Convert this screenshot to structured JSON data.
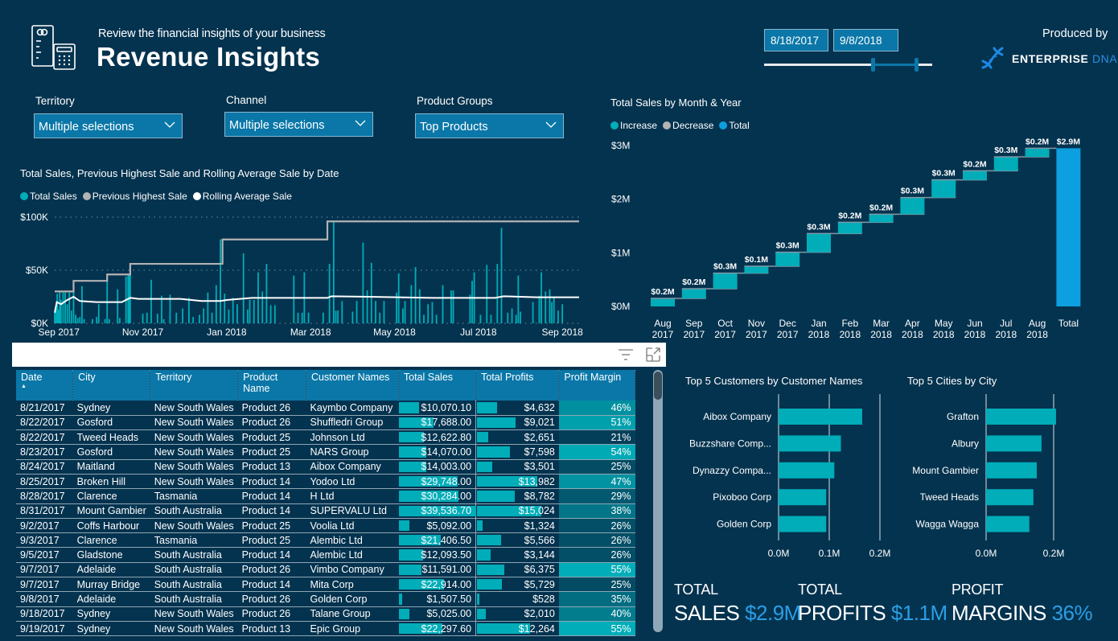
{
  "header": {
    "subtitle": "Review the financial insights of your business",
    "title": "Revenue Insights",
    "produced_by": "Produced by",
    "brand_main": "ENTERPRISE",
    "brand_accent": "DNA"
  },
  "date_range": {
    "start": "8/18/2017",
    "end": "9/8/2018",
    "slider_start_fraction": 0.64,
    "slider_end_fraction": 0.9
  },
  "slicers": [
    {
      "label": "Territory",
      "value": "Multiple selections"
    },
    {
      "label": "Channel",
      "value": "Multiple selections"
    },
    {
      "label": "Product Groups",
      "value": "Top Products"
    }
  ],
  "colors": {
    "background": "#04334f",
    "accent_blue": "#0a77a8",
    "teal": "#00adb8",
    "grey": "#b3b3b3",
    "total_blue": "#0e9fe0",
    "kpi_value": "#2b9ee6"
  },
  "chart_data": [
    {
      "id": "line",
      "type": "line",
      "title": "Total Sales, Previous Highest Sale and Rolling Average Sale by Date",
      "legend": [
        {
          "name": "Total Sales",
          "color": "#00adb8"
        },
        {
          "name": "Previous Highest Sale",
          "color": "#b3b3b3"
        },
        {
          "name": "Rolling Average Sale",
          "color": "#ffffff"
        }
      ],
      "y_ticks": [
        "$0K",
        "$50K",
        "$100K"
      ],
      "ylim": [
        0,
        100000
      ],
      "x_ticks": [
        "Sep 2017",
        "Nov 2017",
        "Jan 2018",
        "Mar 2018",
        "May 2018",
        "Jul 2018",
        "Sep 2018"
      ],
      "x_range_months": [
        0,
        12.5
      ],
      "previous_highest_steps": [
        {
          "x": 0.0,
          "y": 30000
        },
        {
          "x": 0.45,
          "y": 40000
        },
        {
          "x": 1.25,
          "y": 46000
        },
        {
          "x": 1.8,
          "y": 56000
        },
        {
          "x": 4.0,
          "y": 79000
        },
        {
          "x": 6.5,
          "y": 96000
        },
        {
          "x": 12.5,
          "y": 96000
        }
      ],
      "rolling_average": [
        {
          "x": 0.0,
          "y": 10000
        },
        {
          "x": 0.05,
          "y": 20000
        },
        {
          "x": 0.15,
          "y": 18000
        },
        {
          "x": 0.3,
          "y": 22000
        },
        {
          "x": 0.45,
          "y": 25000
        },
        {
          "x": 0.6,
          "y": 21000
        },
        {
          "x": 1.0,
          "y": 20000
        },
        {
          "x": 1.3,
          "y": 20000
        },
        {
          "x": 1.6,
          "y": 20000
        },
        {
          "x": 1.8,
          "y": 24000
        },
        {
          "x": 2.0,
          "y": 23000
        },
        {
          "x": 2.5,
          "y": 23000
        },
        {
          "x": 3.0,
          "y": 23000
        },
        {
          "x": 3.5,
          "y": 21000
        },
        {
          "x": 3.95,
          "y": 21000
        },
        {
          "x": 4.1,
          "y": 22000
        },
        {
          "x": 4.7,
          "y": 24000
        },
        {
          "x": 5.5,
          "y": 24000
        },
        {
          "x": 6.5,
          "y": 24000
        },
        {
          "x": 6.6,
          "y": 25500
        },
        {
          "x": 7.5,
          "y": 25000
        },
        {
          "x": 9.0,
          "y": 24000
        },
        {
          "x": 10.5,
          "y": 24000
        },
        {
          "x": 10.7,
          "y": 25500
        },
        {
          "x": 11.5,
          "y": 24500
        },
        {
          "x": 12.5,
          "y": 24500
        }
      ],
      "total_sales_bars": [
        [
          0.0,
          10000
        ],
        [
          0.03,
          15000
        ],
        [
          0.06,
          28000
        ],
        [
          0.09,
          13000
        ],
        [
          0.12,
          30000
        ],
        [
          0.15,
          22000
        ],
        [
          0.2,
          29000
        ],
        [
          0.25,
          29000
        ],
        [
          0.3,
          18000
        ],
        [
          0.35,
          29000
        ],
        [
          0.4,
          12000
        ],
        [
          0.45,
          40000
        ],
        [
          0.5,
          8000
        ],
        [
          0.55,
          5000
        ],
        [
          0.6,
          6000
        ],
        [
          0.65,
          35000
        ],
        [
          0.7,
          4000
        ],
        [
          0.9,
          4000
        ],
        [
          1.0,
          6000
        ],
        [
          1.05,
          18000
        ],
        [
          1.2,
          4000
        ],
        [
          1.25,
          40000
        ],
        [
          1.3,
          4000
        ],
        [
          1.5,
          32000
        ],
        [
          1.55,
          5000
        ],
        [
          1.7,
          44000
        ],
        [
          1.75,
          45000
        ],
        [
          1.78,
          46000
        ],
        [
          1.8,
          56000
        ],
        [
          2.1,
          9000
        ],
        [
          2.2,
          10000
        ],
        [
          2.3,
          41000
        ],
        [
          2.45,
          9000
        ],
        [
          2.55,
          26000
        ],
        [
          2.6,
          4000
        ],
        [
          2.75,
          27000
        ],
        [
          2.9,
          10000
        ],
        [
          3.05,
          14000
        ],
        [
          3.2,
          24000
        ],
        [
          3.3,
          6000
        ],
        [
          3.45,
          8000
        ],
        [
          3.55,
          14000
        ],
        [
          3.65,
          29000
        ],
        [
          3.75,
          10000
        ],
        [
          3.85,
          36000
        ],
        [
          3.95,
          79000
        ],
        [
          4.05,
          28000
        ],
        [
          4.15,
          13000
        ],
        [
          4.25,
          24000
        ],
        [
          4.35,
          18000
        ],
        [
          4.5,
          66000
        ],
        [
          4.6,
          13000
        ],
        [
          4.65,
          22000
        ],
        [
          4.75,
          22000
        ],
        [
          4.85,
          48000
        ],
        [
          4.95,
          30000
        ],
        [
          5.05,
          56000
        ],
        [
          5.15,
          17000
        ],
        [
          5.25,
          17000
        ],
        [
          5.7,
          45000
        ],
        [
          5.8,
          10000
        ],
        [
          5.9,
          10000
        ],
        [
          5.95,
          48000
        ],
        [
          6.05,
          10000
        ],
        [
          6.4,
          10000
        ],
        [
          6.55,
          56000
        ],
        [
          6.65,
          96000
        ],
        [
          6.7,
          12000
        ],
        [
          6.75,
          12000
        ],
        [
          6.85,
          21000
        ],
        [
          7.1,
          11000
        ],
        [
          7.2,
          21000
        ],
        [
          7.35,
          76000
        ],
        [
          7.45,
          31000
        ],
        [
          7.55,
          57000
        ],
        [
          7.65,
          21000
        ],
        [
          7.75,
          10000
        ],
        [
          7.85,
          21000
        ],
        [
          8.15,
          29000
        ],
        [
          8.2,
          47000
        ],
        [
          8.3,
          14000
        ],
        [
          8.35,
          21000
        ],
        [
          8.5,
          36000
        ],
        [
          8.6,
          53000
        ],
        [
          8.7,
          32000
        ],
        [
          8.8,
          8000
        ],
        [
          8.9,
          18000
        ],
        [
          9.0,
          20000
        ],
        [
          9.1,
          8000
        ],
        [
          9.25,
          36000
        ],
        [
          9.45,
          31000
        ],
        [
          9.5,
          31000
        ],
        [
          9.9,
          27000
        ],
        [
          9.95,
          40000
        ],
        [
          10.0,
          48000
        ],
        [
          10.15,
          8000
        ],
        [
          10.3,
          55000
        ],
        [
          10.4,
          8000
        ],
        [
          10.55,
          56000
        ],
        [
          10.65,
          90000
        ],
        [
          10.8,
          10000
        ],
        [
          10.9,
          14000
        ],
        [
          11.0,
          8000
        ],
        [
          11.05,
          45000
        ],
        [
          11.1,
          11000
        ],
        [
          11.4,
          20000
        ],
        [
          11.55,
          26000
        ],
        [
          11.6,
          48000
        ],
        [
          11.7,
          30000
        ],
        [
          11.8,
          32000
        ],
        [
          11.85,
          20000
        ],
        [
          11.9,
          25000
        ],
        [
          12.0,
          12000
        ],
        [
          12.1,
          18000
        ]
      ]
    },
    {
      "id": "waterfall",
      "type": "bar",
      "subtype": "waterfall",
      "title": "Total Sales by Month & Year",
      "legend": [
        {
          "name": "Increase",
          "color": "#00adb8"
        },
        {
          "name": "Decrease",
          "color": "#b3b3b3"
        },
        {
          "name": "Total",
          "color": "#0e9fe0"
        }
      ],
      "y_ticks": [
        "$0M",
        "$1M",
        "$2M",
        "$3M"
      ],
      "ylim": [
        0,
        3
      ],
      "categories": [
        [
          "Aug",
          "2017"
        ],
        [
          "Sep",
          "2017"
        ],
        [
          "Oct",
          "2017"
        ],
        [
          "Nov",
          "2017"
        ],
        [
          "Dec",
          "2017"
        ],
        [
          "Jan",
          "2018"
        ],
        [
          "Feb",
          "2018"
        ],
        [
          "Mar",
          "2018"
        ],
        [
          "Apr",
          "2018"
        ],
        [
          "May",
          "2018"
        ],
        [
          "Jun",
          "2018"
        ],
        [
          "Jul",
          "2018"
        ],
        [
          "Aug",
          "2018"
        ],
        [
          "Total",
          ""
        ]
      ],
      "values": [
        0.2,
        0.2,
        0.3,
        0.1,
        0.3,
        0.3,
        0.2,
        0.2,
        0.3,
        0.3,
        0.2,
        0.3,
        0.2,
        2.9
      ],
      "labels": [
        "$0.2M",
        "$0.2M",
        "$0.3M",
        "$0.1M",
        "$0.3M",
        "$0.3M",
        "$0.2M",
        "$0.2M",
        "$0.3M",
        "$0.3M",
        "$0.2M",
        "$0.3M",
        "$0.2M",
        "$2.9M"
      ],
      "cumulative_end": [
        0.15,
        0.33,
        0.62,
        0.75,
        1.01,
        1.36,
        1.57,
        1.72,
        2.03,
        2.36,
        2.53,
        2.79,
        2.95,
        2.95
      ],
      "cumulative_start": [
        0.0,
        0.15,
        0.33,
        0.62,
        0.75,
        1.01,
        1.36,
        1.57,
        1.72,
        2.03,
        2.36,
        2.53,
        2.79,
        0.0
      ]
    },
    {
      "id": "customers",
      "type": "bar",
      "orientation": "horizontal",
      "title": "Top 5 Customers by Customer Names",
      "categories": [
        "Aibox Company",
        "Buzzshare Comp...",
        "Dynazzy Compa...",
        "Pixoboo Corp",
        "Golden Corp"
      ],
      "values": [
        0.165,
        0.123,
        0.11,
        0.094,
        0.094
      ],
      "x_ticks": [
        "0.0M",
        "0.1M",
        "0.2M"
      ],
      "xlim": [
        0,
        0.2
      ]
    },
    {
      "id": "cities",
      "type": "bar",
      "orientation": "horizontal",
      "title": "Top 5 Cities by City",
      "categories": [
        "Grafton",
        "Albury",
        "Mount Gambier",
        "Tweed Heads",
        "Wagga Wagga"
      ],
      "values": [
        0.207,
        0.164,
        0.15,
        0.14,
        0.128
      ],
      "x_ticks": [
        "0.0M",
        "0.2M"
      ],
      "xlim": [
        0,
        0.2
      ]
    }
  ],
  "table": {
    "columns": [
      "Date",
      "City",
      "Territory",
      "Product Name",
      "Customer Names",
      "Total Sales",
      "Total Profits",
      "Profit Margin"
    ],
    "sort_indicator": "▲",
    "rows": [
      [
        "8/21/2017",
        "Sydney",
        "New South Wales",
        "Product 26",
        "Kaymbo Company",
        "$10,070.10",
        "$4,632",
        "46%"
      ],
      [
        "8/22/2017",
        "Gosford",
        "New South Wales",
        "Product 26",
        "Shuffledri Group",
        "$17,688.00",
        "$9,021",
        "51%"
      ],
      [
        "8/22/2017",
        "Tweed Heads",
        "New South Wales",
        "Product 25",
        "Johnson Ltd",
        "$12,622.80",
        "$2,651",
        "21%"
      ],
      [
        "8/23/2017",
        "Gosford",
        "New South Wales",
        "Product 25",
        "NARS Group",
        "$14,070.00",
        "$7,598",
        "54%"
      ],
      [
        "8/24/2017",
        "Maitland",
        "New South Wales",
        "Product 13",
        "Aibox Company",
        "$14,003.00",
        "$3,501",
        "25%"
      ],
      [
        "8/25/2017",
        "Broken Hill",
        "New South Wales",
        "Product 14",
        "Yodoo Ltd",
        "$29,748.00",
        "$13,982",
        "47%"
      ],
      [
        "8/28/2017",
        "Clarence",
        "Tasmania",
        "Product 14",
        "H Ltd",
        "$30,284.00",
        "$8,782",
        "29%"
      ],
      [
        "8/31/2017",
        "Mount Gambier",
        "South Australia",
        "Product 14",
        "SUPERVALU Ltd",
        "$39,536.70",
        "$15,024",
        "38%"
      ],
      [
        "9/2/2017",
        "Coffs Harbour",
        "New South Wales",
        "Product 25",
        "Voolia Ltd",
        "$5,092.00",
        "$1,324",
        "26%"
      ],
      [
        "9/3/2017",
        "Clarence",
        "Tasmania",
        "Product 25",
        "Alembic Ltd",
        "$21,406.50",
        "$5,566",
        "26%"
      ],
      [
        "9/5/2017",
        "Gladstone",
        "South Australia",
        "Product 14",
        "Alembic Ltd",
        "$12,093.50",
        "$3,144",
        "26%"
      ],
      [
        "9/7/2017",
        "Adelaide",
        "South Australia",
        "Product 26",
        "Vimbo Company",
        "$11,591.00",
        "$6,375",
        "55%"
      ],
      [
        "9/7/2017",
        "Murray Bridge",
        "South Australia",
        "Product 14",
        "Mita Corp",
        "$22,914.00",
        "$5,729",
        "25%"
      ],
      [
        "9/8/2017",
        "Adelaide",
        "South Australia",
        "Product 26",
        "Golden Corp",
        "$1,507.50",
        "$528",
        "35%"
      ],
      [
        "9/18/2017",
        "Sydney",
        "New South Wales",
        "Product 26",
        "Talane Group",
        "$5,025.00",
        "$2,010",
        "40%"
      ],
      [
        "9/19/2017",
        "Sydney",
        "New South Wales",
        "Product 13",
        "Epic Group",
        "$22,297.60",
        "$12,264",
        "55%"
      ]
    ],
    "sales_values": [
      10070.1,
      17688,
      12622.8,
      14070,
      14003,
      29748,
      30284,
      39536.7,
      5092,
      21406.5,
      12093.5,
      11591,
      22914,
      1507.5,
      5025,
      22297.6
    ],
    "profit_values": [
      4632,
      9021,
      2651,
      7598,
      3501,
      13982,
      8782,
      15024,
      1324,
      5566,
      3144,
      6375,
      5729,
      528,
      2010,
      12264
    ],
    "margin_values": [
      46,
      51,
      21,
      54,
      25,
      47,
      29,
      38,
      26,
      26,
      26,
      55,
      25,
      35,
      40,
      55
    ]
  },
  "kpis": {
    "sales": {
      "label": "TOTAL",
      "name": "SALES",
      "value": "$2.9M"
    },
    "profits": {
      "label": "TOTAL",
      "name": "PROFITS",
      "value": "$1.1M"
    },
    "margins": {
      "label": "PROFIT",
      "name": "MARGINS",
      "value": "36%"
    }
  }
}
